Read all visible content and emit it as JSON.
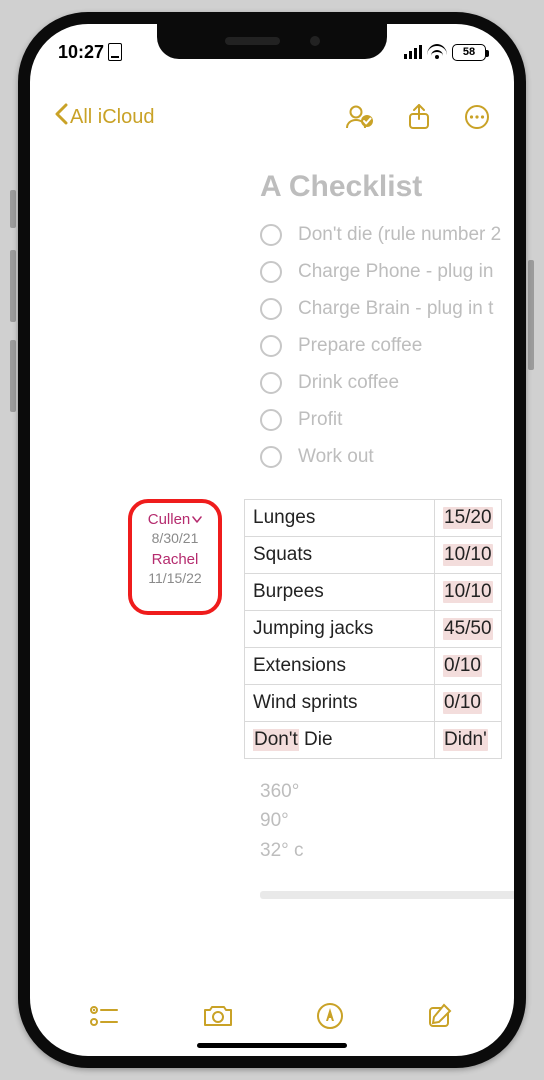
{
  "status": {
    "time": "10:27",
    "battery": "58"
  },
  "nav": {
    "back": "All iCloud"
  },
  "note": {
    "title": "A Checklist",
    "checklist": [
      "Don't die (rule number 2",
      "Charge Phone - plug in ",
      "Charge Brain - plug in t",
      "Prepare coffee",
      "Drink coffee",
      "Profit",
      "Work out"
    ],
    "contributors": [
      {
        "name": "Cullen",
        "date": "8/30/21"
      },
      {
        "name": "Rachel",
        "date": "11/15/22"
      }
    ],
    "table": [
      {
        "name": "Lunges",
        "value": "15/20"
      },
      {
        "name": "Squats",
        "value": "10/10"
      },
      {
        "name": "Burpees",
        "value": "10/10"
      },
      {
        "name": "Jumping jacks",
        "value": "45/50"
      },
      {
        "name": "Extensions",
        "value": "0/10"
      },
      {
        "name": "Wind sprints",
        "value": "0/10"
      },
      {
        "name_hl": "Don't",
        "name_rest": "Die",
        "value": "Didn'"
      }
    ],
    "extras": [
      "360°",
      "90°",
      "32° c"
    ]
  },
  "colors": {
    "accent": "#c9a227",
    "contributor": "#b52b6e",
    "callout": "#ef1c1c"
  }
}
